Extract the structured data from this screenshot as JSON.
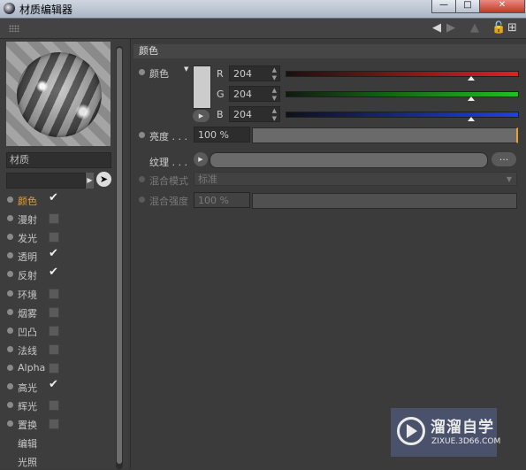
{
  "window": {
    "title": "材质编辑器"
  },
  "left": {
    "material_name": "材质",
    "channels": [
      {
        "label": "颜色",
        "checked": true,
        "active": true
      },
      {
        "label": "漫射",
        "checked": false
      },
      {
        "label": "发光",
        "checked": false
      },
      {
        "label": "透明",
        "checked": true
      },
      {
        "label": "反射",
        "checked": true
      },
      {
        "label": "环境",
        "checked": false
      },
      {
        "label": "烟雾",
        "checked": false
      },
      {
        "label": "凹凸",
        "checked": false
      },
      {
        "label": "法线",
        "checked": false
      },
      {
        "label": "Alpha",
        "checked": false
      },
      {
        "label": "高光",
        "checked": true
      },
      {
        "label": "辉光",
        "checked": false
      },
      {
        "label": "置换",
        "checked": false
      },
      {
        "label": "编辑",
        "nodot": true
      },
      {
        "label": "光照",
        "nodot": true
      }
    ]
  },
  "right": {
    "section_title": "颜色",
    "color_label": "颜色",
    "swatch_color": "#cccccc",
    "r_label": "R",
    "r_value": "204",
    "g_label": "G",
    "g_value": "204",
    "b_label": "B",
    "b_value": "204",
    "rgb_level": 0.8,
    "brightness_label": "亮度 . . .",
    "brightness_value": "100 %",
    "texture_label": "纹理 . . .",
    "texture_more": "...",
    "blend_mode_label": "混合模式",
    "blend_mode_value": "标准",
    "blend_strength_label": "混合强度",
    "blend_strength_value": "100 %"
  },
  "watermark": {
    "title": "溜溜自学",
    "url": "ZIXUE.3D66.COM"
  },
  "colors": {
    "accent": "#e8a030",
    "red": "#e02020",
    "green": "#20c020",
    "blue": "#2040e0"
  }
}
